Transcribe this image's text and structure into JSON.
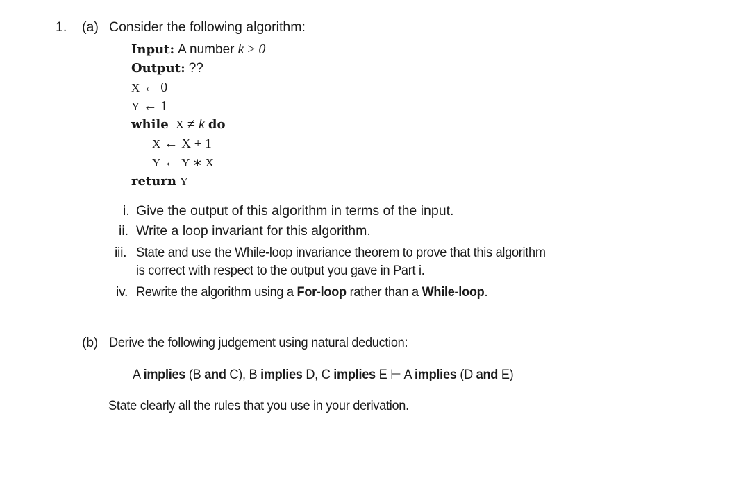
{
  "question": {
    "number": "1.",
    "part_a": {
      "label": "(a)",
      "intro": "Consider the following algorithm:",
      "algorithm": {
        "input_label": "Input:",
        "input_text": "A number",
        "input_math": "k ≥ 0",
        "output_label": "Output:",
        "output_text": "??",
        "lines": [
          {
            "var": "X",
            "op": "←",
            "expr": "0"
          },
          {
            "var": "Y",
            "op": "←",
            "expr": "1"
          }
        ],
        "while_kw": "while",
        "while_cond_var": "X",
        "while_cond_op": "≠",
        "while_cond_k": "k",
        "do_kw": "do",
        "body": [
          {
            "var": "X",
            "op": "←",
            "expr": "X + 1"
          },
          {
            "var": "Y",
            "op": "←",
            "expr": "Y ∗ X"
          }
        ],
        "return_kw": "return",
        "return_var": "Y"
      },
      "subparts": [
        {
          "label": "i.",
          "text": "Give the output of this algorithm in terms of the input."
        },
        {
          "label": "ii.",
          "text": "Write a loop invariant for this algorithm."
        },
        {
          "label": "iii.",
          "text_line1": "State and use the While-loop invariance theorem to prove that this algorithm",
          "text_line2": "is correct with respect to the output you gave in Part i."
        },
        {
          "label": "iv.",
          "text_pre": "Rewrite the algorithm using a ",
          "bold1": "For-loop",
          "text_mid": " rather than a ",
          "bold2": "While-loop",
          "text_post": "."
        }
      ]
    },
    "part_b": {
      "label": "(b)",
      "intro": "Derive the following judgement using natural deduction:",
      "judgement": [
        {
          "t": "A ",
          "b": false
        },
        {
          "t": "implies",
          "b": true
        },
        {
          "t": " (B ",
          "b": false
        },
        {
          "t": "and",
          "b": true
        },
        {
          "t": " C), B ",
          "b": false
        },
        {
          "t": "implies",
          "b": true
        },
        {
          "t": " D, C ",
          "b": false
        },
        {
          "t": "implies",
          "b": true
        },
        {
          "t": " E ⊢ A ",
          "b": false
        },
        {
          "t": "implies",
          "b": true
        },
        {
          "t": " (D ",
          "b": false
        },
        {
          "t": "and",
          "b": true
        },
        {
          "t": " E)",
          "b": false
        }
      ],
      "instruction": "State clearly all the rules that you use in your derivation."
    }
  }
}
